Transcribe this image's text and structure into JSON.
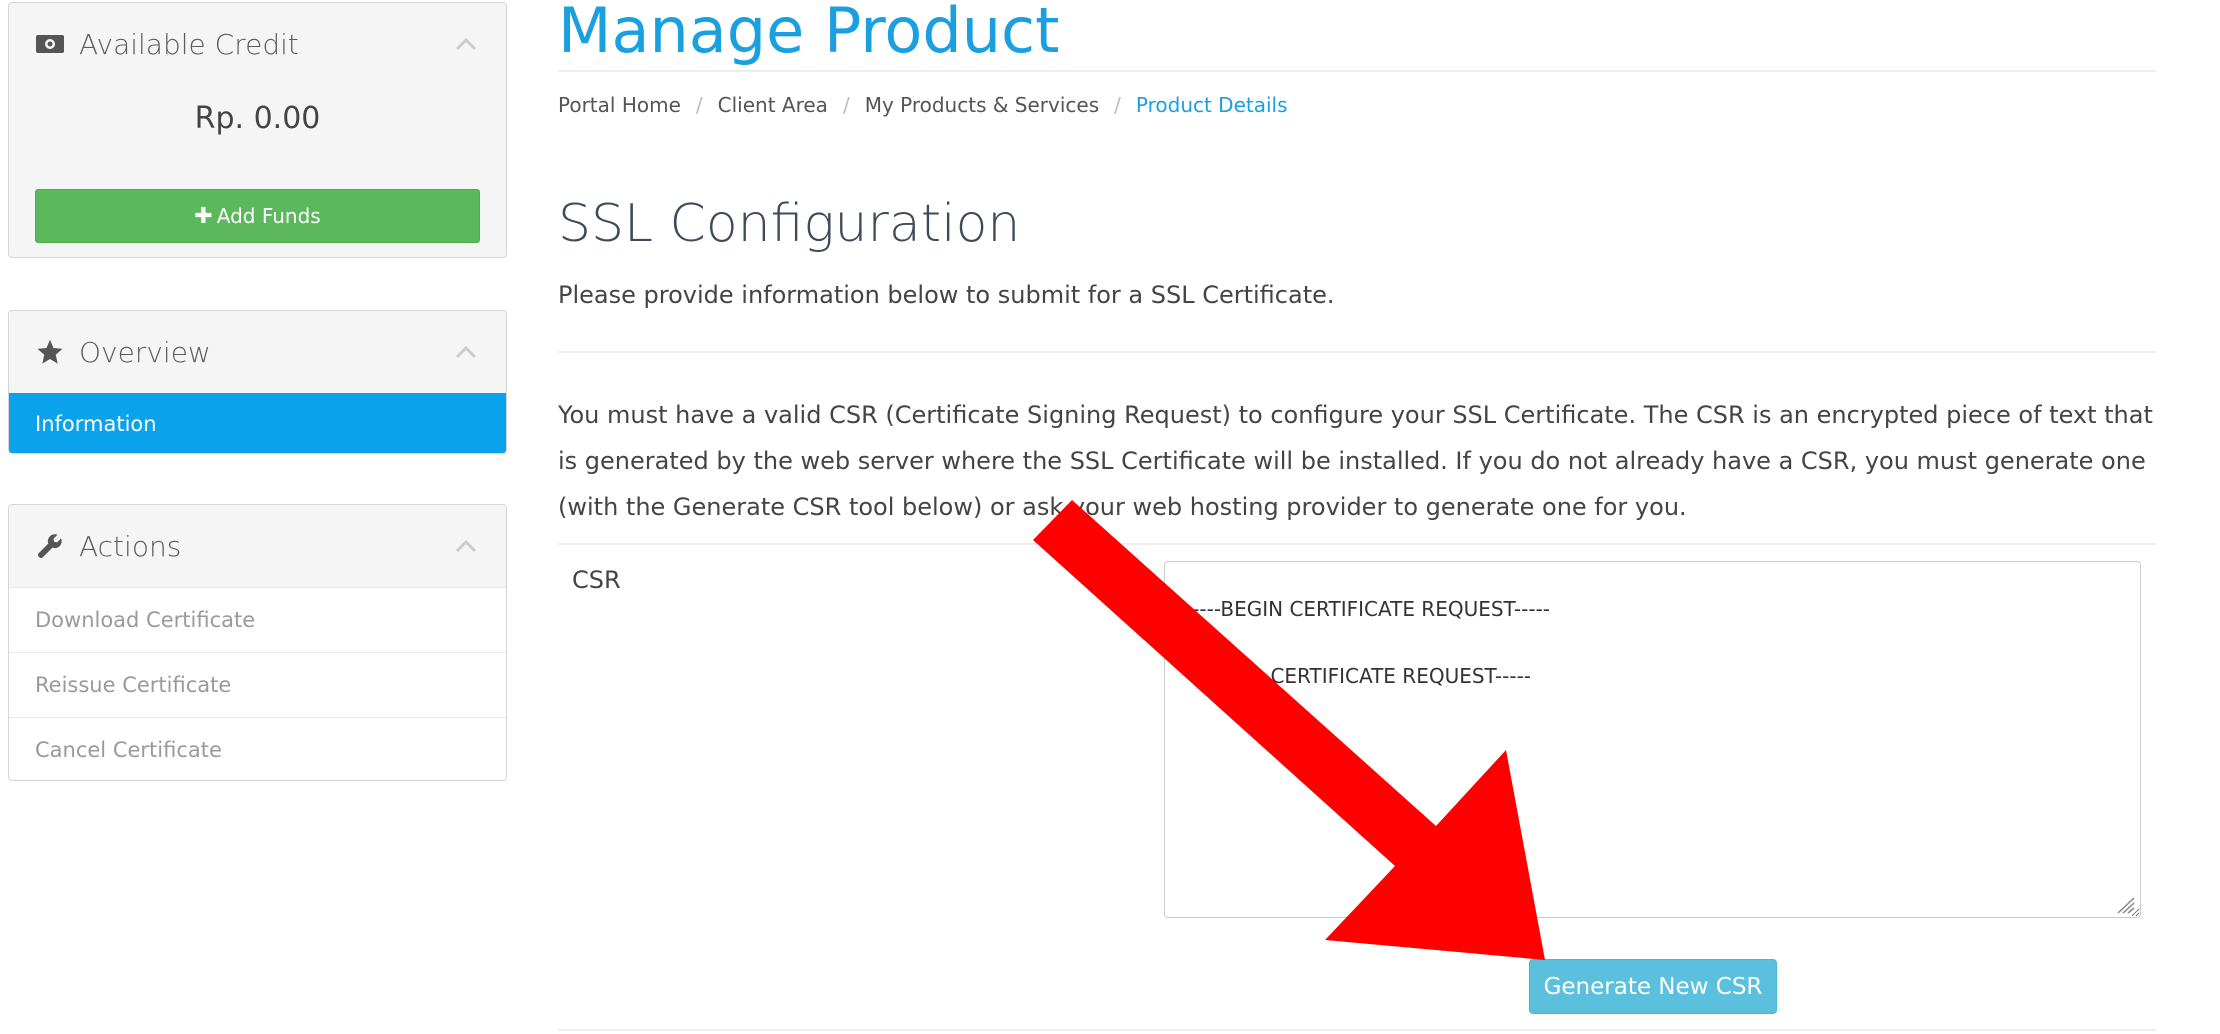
{
  "sidebar": {
    "credit": {
      "title": "Available Credit",
      "amount": "Rp. 0.00",
      "add_funds_label": "Add Funds",
      "add_funds_icon": "plus-icon"
    },
    "overview": {
      "title": "Overview",
      "icon": "star-icon",
      "items": [
        {
          "label": "Information",
          "active": true
        }
      ]
    },
    "actions": {
      "title": "Actions",
      "icon": "wrench-icon",
      "items": [
        {
          "label": "Download Certificate"
        },
        {
          "label": "Reissue Certificate"
        },
        {
          "label": "Cancel Certificate"
        }
      ]
    }
  },
  "main": {
    "page_title": "Manage Product",
    "breadcrumb": [
      "Portal Home",
      "Client Area",
      "My Products & Services",
      "Product Details"
    ],
    "section_title": "SSL Configuration",
    "section_subtitle": "Please provide information below to submit for a SSL Certificate.",
    "csr_info": "You must have a valid CSR (Certificate Signing Request) to configure your SSL Certificate. The CSR is an encrypted piece of text that is generated by the web server where the SSL Certificate will be installed. If you do not already have a CSR, you must generate one (with the Generate CSR tool below) or ask your web hosting provider to generate one for you.",
    "csr_label": "CSR",
    "csr_value": "-----BEGIN CERTIFICATE REQUEST-----\n-----END CERTIFICATE REQUEST-----",
    "generate_button": "Generate New CSR"
  },
  "colors": {
    "accent": "#1a9fe0",
    "active_item": "#0ba2ec",
    "add_funds": "#5cb85c",
    "generate_button": "#5bc0de",
    "annotation_arrow": "#ff0000"
  }
}
